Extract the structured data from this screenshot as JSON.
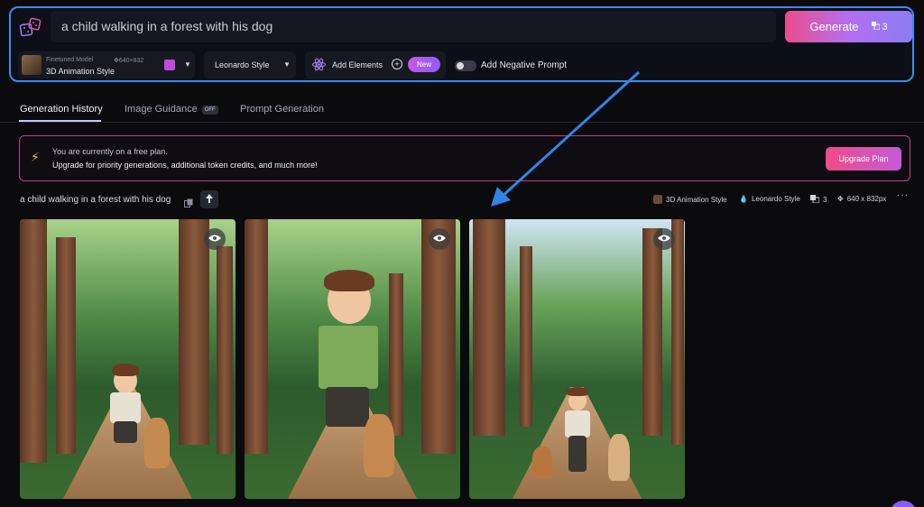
{
  "prompt": {
    "text": "a child walking in a forest with his dog"
  },
  "generate": {
    "label": "Generate",
    "count": "3"
  },
  "model": {
    "subtitle": "Finetuned Model",
    "dimensions": "640×832",
    "name": "3D Animation Style"
  },
  "style": {
    "label": "Leonardo Style"
  },
  "elements": {
    "label": "Add Elements",
    "badge": "New"
  },
  "negative": {
    "label": "Add Negative Prompt"
  },
  "tabs": [
    {
      "label": "Generation History"
    },
    {
      "label": "Image Guidance",
      "badge": "OFF"
    },
    {
      "label": "Prompt Generation"
    }
  ],
  "banner": {
    "line1": "You are currently on a free plan.",
    "line2": "Upgrade for priority generations, additional token credits, and much more!",
    "button": "Upgrade Plan"
  },
  "generation": {
    "prompt": "a child walking in a forest with his dog",
    "model": "3D Animation Style",
    "style": "Leonardo Style",
    "count": "3",
    "size": "640 x 832px"
  },
  "colors": {
    "accent_blue": "#3d8cf0",
    "generate_start": "#ec4d8a",
    "generate_end": "#8c7cf5",
    "banner_border": "#c4418a"
  }
}
